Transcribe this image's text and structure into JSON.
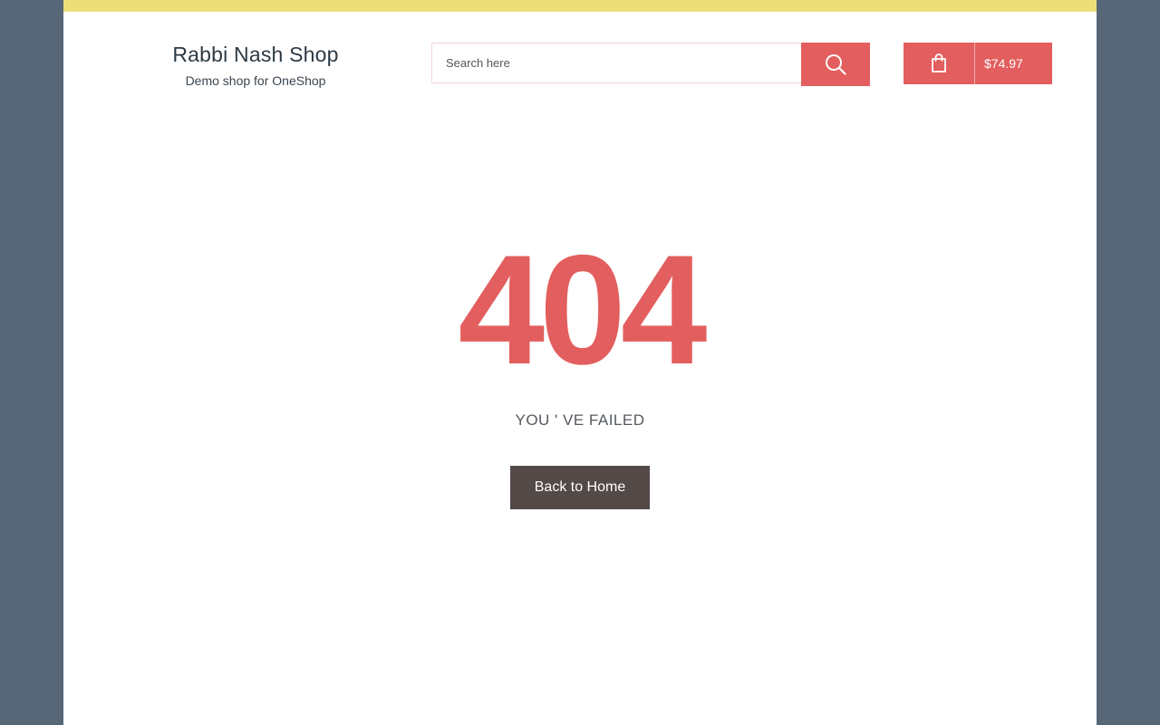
{
  "header": {
    "site_title": "Rabbi Nash Shop",
    "tagline": "Demo shop for OneShop"
  },
  "search": {
    "placeholder": "Search here",
    "button_icon": "search-icon"
  },
  "cart": {
    "icon": "shopping-bag-icon",
    "total": "$74.97"
  },
  "error": {
    "code": "404",
    "message": "YOU ' VE FAILED",
    "home_button_label": "Back to Home"
  },
  "colors": {
    "accent": "#e35e5e",
    "topbar": "#eede7a",
    "background": "#576778",
    "home_button": "#534946"
  }
}
